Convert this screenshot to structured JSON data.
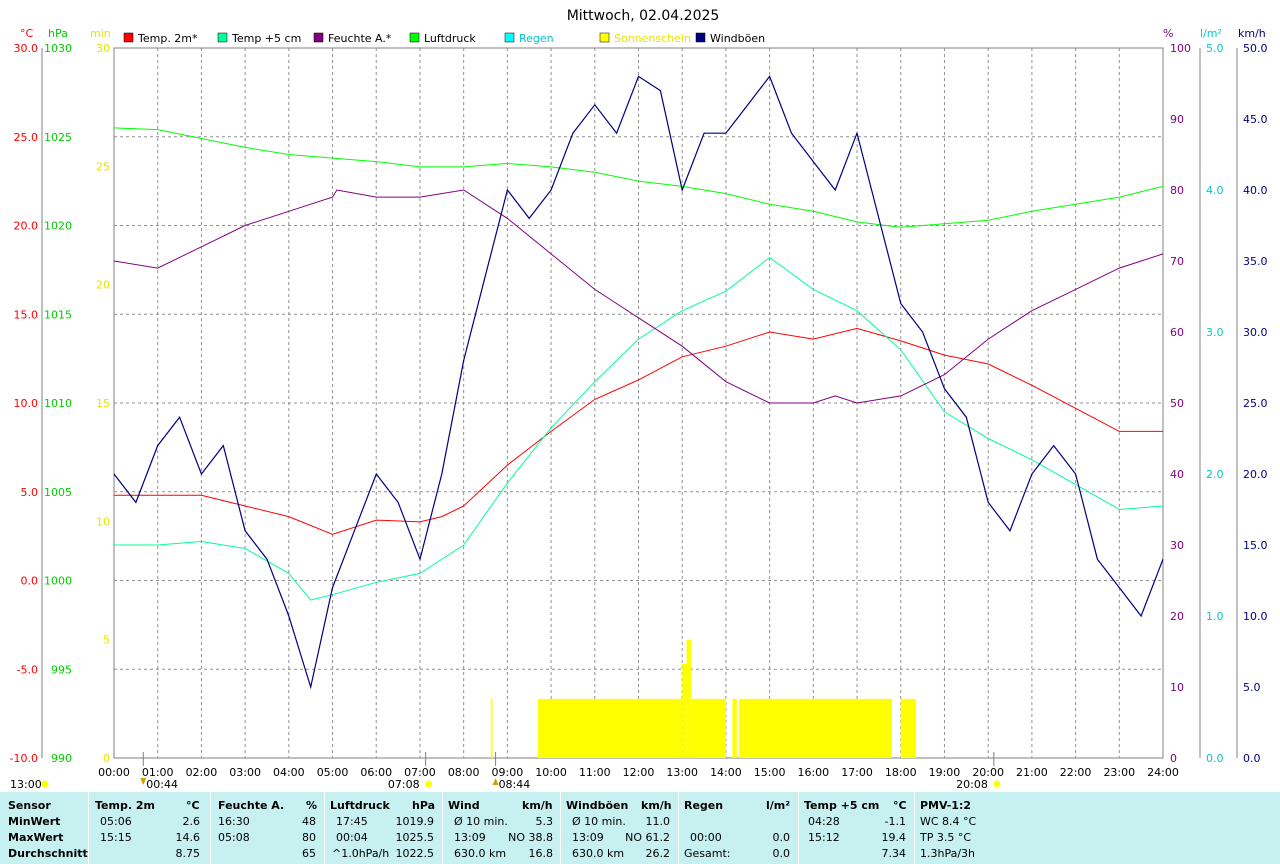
{
  "chart_data": {
    "type": "line",
    "title": "Mittwoch, 02.04.2025",
    "axis_units": {
      "temp": "°C",
      "pressure": "hPa",
      "sun": "min",
      "humidity": "%",
      "rain": "l/m²",
      "wind": "km/h"
    },
    "temp_ticks": [
      "30.0",
      "25.0",
      "20.0",
      "15.0",
      "10.0",
      "5.0",
      "0.0",
      "-5.0",
      "-10.0"
    ],
    "pressure_ticks": [
      "1030",
      "1025",
      "1020",
      "1015",
      "1010",
      "1005",
      "1000",
      "995",
      "990"
    ],
    "sun_ticks": [
      "30",
      "25",
      "20",
      "15",
      "10",
      "5",
      "0"
    ],
    "humidity_ticks": [
      "100",
      "90",
      "80",
      "70",
      "60",
      "50",
      "40",
      "30",
      "20",
      "10",
      "0"
    ],
    "rain_ticks": [
      "5.0",
      "4.0",
      "3.0",
      "2.0",
      "1.0",
      "0.0"
    ],
    "wind_ticks": [
      "50.0",
      "45.0",
      "40.0",
      "35.0",
      "30.0",
      "25.0",
      "20.0",
      "15.0",
      "10.0",
      "5.0",
      "0.0"
    ],
    "time_labels": [
      "00:00",
      "01:00",
      "02:00",
      "03:00",
      "04:00",
      "05:00",
      "06:00",
      "07:00",
      "08:00",
      "09:00",
      "10:00",
      "11:00",
      "12:00",
      "13:00",
      "14:00",
      "15:00",
      "16:00",
      "17:00",
      "18:00",
      "19:00",
      "20:00",
      "21:00",
      "22:00",
      "23:00",
      "24:00"
    ],
    "y_ranges": {
      "temp": [
        -10,
        30
      ],
      "pressure": [
        990,
        1030
      ],
      "sun": [
        0,
        30
      ],
      "humidity": [
        0,
        100
      ],
      "rain": [
        0,
        5
      ],
      "wind": [
        0,
        50
      ]
    },
    "series": [
      {
        "name": "Temp. 2m*",
        "color": "#ff0000",
        "axis": "temp",
        "x": [
          0,
          1,
          2,
          3,
          4,
          5,
          6,
          7,
          7.5,
          8,
          9,
          10,
          11,
          12,
          13,
          14,
          15,
          16,
          17,
          18,
          19,
          20,
          21,
          22,
          23,
          24
        ],
        "y": [
          4.8,
          4.8,
          4.8,
          4.2,
          3.6,
          2.6,
          3.4,
          3.3,
          3.6,
          4.2,
          6.5,
          8.4,
          10.2,
          11.3,
          12.6,
          13.2,
          14.0,
          13.6,
          14.2,
          13.5,
          12.7,
          12.2,
          11.0,
          9.7,
          8.4,
          8.4
        ]
      },
      {
        "name": "Temp +5 cm",
        "color": "#00ff99",
        "axis": "temp",
        "x": [
          0,
          1,
          2,
          3,
          4,
          4.5,
          5,
          6,
          7,
          8,
          9,
          10,
          11,
          12,
          13,
          14,
          15,
          16,
          17,
          18,
          19,
          20,
          21,
          22,
          23,
          24
        ],
        "y": [
          2.0,
          2.0,
          2.2,
          1.8,
          0.4,
          -1.1,
          -0.8,
          -0.1,
          0.4,
          2.0,
          5.5,
          8.6,
          11.2,
          13.6,
          15.2,
          16.3,
          18.2,
          16.4,
          15.2,
          13.0,
          9.5,
          8.0,
          6.8,
          5.4,
          4.0,
          4.2
        ]
      },
      {
        "name": "Feuchte A.*",
        "color": "#800080",
        "axis": "humidity",
        "x": [
          0,
          1,
          2,
          3,
          4,
          5,
          5.1,
          6,
          7,
          8,
          9,
          10,
          11,
          12,
          13,
          14,
          15,
          16,
          16.5,
          17,
          18,
          19,
          20,
          21,
          22,
          23,
          24
        ],
        "y": [
          70,
          69,
          72,
          75,
          77,
          79,
          80,
          79,
          79,
          80,
          76,
          71,
          66,
          62,
          58,
          53,
          50,
          50,
          51,
          50,
          51,
          54,
          59,
          63,
          66,
          69,
          71
        ]
      },
      {
        "name": "Luftdruck",
        "color": "#00ff00",
        "axis": "pressure",
        "x": [
          0,
          1,
          2,
          3,
          4,
          5,
          6,
          7,
          8,
          9,
          10,
          11,
          12,
          13,
          14,
          15,
          16,
          17,
          18,
          19,
          20,
          21,
          22,
          23,
          24
        ],
        "y": [
          1025.5,
          1025.4,
          1024.9,
          1024.4,
          1024.0,
          1023.8,
          1023.6,
          1023.3,
          1023.3,
          1023.5,
          1023.3,
          1023.0,
          1022.5,
          1022.2,
          1021.8,
          1021.2,
          1020.8,
          1020.2,
          1019.9,
          1020.1,
          1020.3,
          1020.8,
          1021.2,
          1021.6,
          1022.2
        ]
      },
      {
        "name": "Regen",
        "color": "#00ffff",
        "axis": "rain",
        "x": [],
        "y": []
      },
      {
        "name": "Sonnenschein",
        "color": "#ffff00",
        "axis": "sun",
        "x": [],
        "y": []
      },
      {
        "name": "Windböen",
        "color": "#000080",
        "axis": "wind",
        "x": [
          0,
          0.5,
          1,
          1.5,
          2,
          2.5,
          3,
          3.5,
          4,
          4.5,
          5,
          5.5,
          6,
          6.5,
          7,
          7.5,
          8,
          8.5,
          9,
          9.5,
          10,
          10.5,
          11,
          11.5,
          12,
          12.5,
          13,
          13.5,
          14,
          14.5,
          15,
          15.5,
          16,
          16.5,
          17,
          17.5,
          18,
          18.5,
          19,
          19.5,
          20,
          20.5,
          21,
          21.5,
          22,
          22.5,
          23,
          23.5,
          24
        ],
        "y": [
          20,
          18,
          22,
          24,
          20,
          22,
          16,
          14,
          10,
          5,
          12,
          16,
          20,
          18,
          14,
          20,
          28,
          34,
          40,
          38,
          40,
          44,
          46,
          44,
          48,
          47,
          40,
          44,
          44,
          46,
          48,
          44,
          42,
          40,
          44,
          38,
          32,
          30,
          26,
          24,
          18,
          16,
          20,
          22,
          20,
          14,
          12,
          10,
          14
        ]
      }
    ],
    "sunshine_blocks": [
      {
        "x0": 8.62,
        "x1": 8.66,
        "value": 2.5
      },
      {
        "x0": 9.7,
        "x1": 13.0,
        "value": 2.5
      },
      {
        "x0": 13.0,
        "x1": 13.1,
        "value": 4.0
      },
      {
        "x0": 13.1,
        "x1": 13.2,
        "value": 5.0
      },
      {
        "x0": 13.2,
        "x1": 14.0,
        "value": 2.5
      },
      {
        "x0": 14.15,
        "x1": 14.25,
        "value": 2.5
      },
      {
        "x0": 14.3,
        "x1": 17.8,
        "value": 2.5
      },
      {
        "x0": 18.0,
        "x1": 18.35,
        "value": 2.5
      }
    ],
    "bottom_labels": [
      {
        "time": 0.67,
        "label": "00:44",
        "kind": "down"
      },
      {
        "time": 7.13,
        "label": "07:08",
        "kind": "sunrise"
      },
      {
        "time": 8.73,
        "label": "08:44",
        "kind": "up"
      },
      {
        "time": 20.13,
        "label": "20:08",
        "kind": "sunset"
      }
    ],
    "bottom_left_label": "13:00",
    "grid": true,
    "legend_placement": "top"
  },
  "stats": {
    "headers": {
      "sensor": "Sensor",
      "temp": "Temp. 2m",
      "temp_unit": "°C",
      "hum": "Feuchte A.",
      "hum_unit": "%",
      "press": "Luftdruck",
      "press_unit": "hPa",
      "wind": "Wind",
      "wind_unit": "km/h",
      "gust": "Windböen",
      "gust_unit": "km/h",
      "rain": "Regen",
      "rain_unit": "l/m²",
      "t5": "Temp +5 cm",
      "t5_unit": "°C",
      "pmv": "PMV-1:2"
    },
    "rows": {
      "min": {
        "label": "MinWert",
        "temp_t": "05:06",
        "temp_v": "2.6",
        "hum_t": "16:30",
        "hum_v": "48",
        "press_t": "17:45",
        "press_v": "1019.9",
        "wind_t": "Ø 10 min.",
        "wind_v": "5.3",
        "gust_t": "Ø 10 min.",
        "gust_v": "11.0",
        "rain_t": "",
        "rain_v": "",
        "t5_t": "04:28",
        "t5_v": "-1.1",
        "pmv": "WC 8.4 °C"
      },
      "max": {
        "label": "MaxWert",
        "temp_t": "15:15",
        "temp_v": "14.6",
        "hum_t": "05:08",
        "hum_v": "80",
        "press_t": "00:04",
        "press_v": "1025.5",
        "wind_t": "13:09",
        "wind_d": "NO 38.8",
        "gust_t": "13:09",
        "gust_d": "NO 61.2",
        "rain_t": "00:00",
        "rain_v": "0.0",
        "t5_t": "15:12",
        "t5_v": "19.4",
        "pmv": "TP 3.5 °C"
      },
      "avg": {
        "label": "Durchschnitt",
        "temp_v": "8.75",
        "hum_v": "65",
        "press_t": "^1.0hPa/h",
        "press_v": "1022.5",
        "wind_t": "630.0 km",
        "wind_v": "16.8",
        "gust_t": "630.0 km",
        "gust_v": "26.2",
        "rain_t": "Gesamt:",
        "rain_v": "0.0",
        "t5_v": "7.34",
        "pmv": "1.3hPa/3h"
      }
    }
  }
}
